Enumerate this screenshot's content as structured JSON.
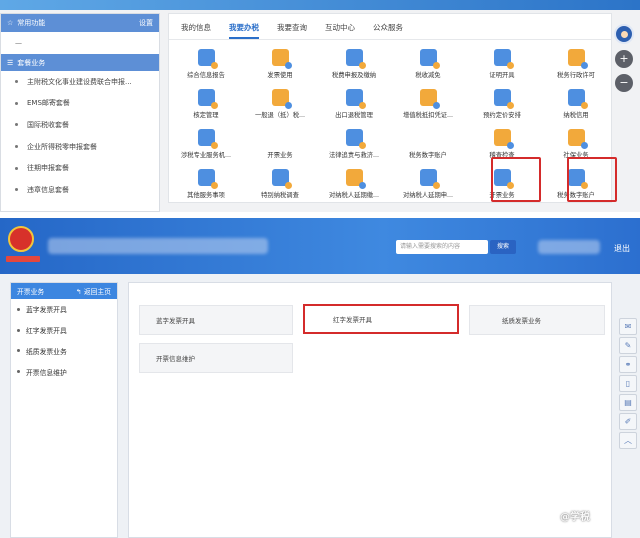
{
  "top": {
    "left_panel": {
      "header_label": "常用功能",
      "settings_label": "设置",
      "dash": "—",
      "section_label": "套餐业务",
      "items": [
        "主附税文化事业建设费联合申报...",
        "EMS邮寄套餐",
        "国际税收套餐",
        "企业所得税零申报套餐",
        "往期申报套餐",
        "违章信息套餐"
      ]
    },
    "tabs": [
      {
        "label": "我的信息",
        "active": false
      },
      {
        "label": "我要办税",
        "active": true
      },
      {
        "label": "我要查询",
        "active": false
      },
      {
        "label": "互动中心",
        "active": false
      },
      {
        "label": "公众服务",
        "active": false
      }
    ],
    "grid": [
      [
        {
          "label": "综合信息报告",
          "icon": "report-icon",
          "color": "blue",
          "name": "综合信息报告"
        },
        {
          "label": "发票使用",
          "icon": "invoice-icon",
          "color": "orange",
          "name": "发票使用"
        },
        {
          "label": "税费申报及缴纳",
          "icon": "tax-declare-icon",
          "color": "blue",
          "name": "税费申报及缴纳"
        },
        {
          "label": "税收减免",
          "icon": "tax-reduction-icon",
          "color": "blue",
          "name": "税收减免"
        },
        {
          "label": "证明开具",
          "icon": "certificate-icon",
          "color": "blue",
          "name": "证明开具"
        },
        {
          "label": "税务行政许可",
          "icon": "license-icon",
          "color": "orange",
          "name": "税务行政许可"
        }
      ],
      [
        {
          "label": "核定管理",
          "icon": "verify-icon",
          "color": "blue",
          "name": "核定管理"
        },
        {
          "label": "一般退（抵）税...",
          "icon": "refund-icon",
          "color": "orange",
          "name": "一般退抵税"
        },
        {
          "label": "出口退税管理",
          "icon": "export-refund-icon",
          "color": "blue",
          "name": "出口退税管理"
        },
        {
          "label": "增值税抵扣凭证...",
          "icon": "vat-voucher-icon",
          "color": "orange",
          "name": "增值税抵扣凭证"
        },
        {
          "label": "预约定价安排",
          "icon": "calendar-icon",
          "color": "blue",
          "name": "预约定价安排"
        },
        {
          "label": "纳税信用",
          "icon": "credit-icon",
          "color": "blue",
          "name": "纳税信用"
        }
      ],
      [
        {
          "label": "涉税专业服务机...",
          "icon": "building-icon",
          "color": "blue",
          "name": "涉税专业服务机构"
        },
        {
          "label": "开票业务",
          "icon": "blank-icon",
          "color": "none",
          "name": "开票业务-a"
        },
        {
          "label": "法律追责与救济...",
          "icon": "gavel-icon",
          "color": "blue",
          "name": "法律追责与救济"
        },
        {
          "label": "税务数字账户",
          "icon": "blank-icon",
          "color": "none",
          "name": "税务数字账户-a"
        },
        {
          "label": "稽查检查",
          "icon": "shield-icon",
          "color": "orange",
          "name": "稽查检查"
        },
        {
          "label": "社保业务",
          "icon": "social-security-icon",
          "color": "orange",
          "name": "社保业务"
        }
      ],
      [
        {
          "label": "其他服务事项",
          "icon": "heart-icon",
          "color": "blue",
          "name": "其他服务事项"
        },
        {
          "label": "特别纳税调查",
          "icon": "investigate-icon",
          "color": "blue",
          "name": "特别纳税调查"
        },
        {
          "label": "对纳税人延期缴...",
          "icon": "deferral-icon",
          "color": "orange",
          "name": "对纳税人延期缴"
        },
        {
          "label": "对纳税人延期申...",
          "icon": "deferral-declare-icon",
          "color": "blue",
          "name": "对纳税人延期申"
        },
        {
          "label": "开票业务",
          "icon": "invoicing-icon",
          "color": "blue",
          "name": "开票业务-b"
        },
        {
          "label": "税务数字账户",
          "icon": "digital-account-icon",
          "color": "blue",
          "name": "税务数字账户-b"
        }
      ]
    ],
    "tools": {
      "zoom_in": "+",
      "zoom_out": "−"
    }
  },
  "bottom": {
    "search_placeholder": "请输入需要搜索的内容",
    "search_button": "搜索",
    "logout": "退出",
    "side_title": "开票业务",
    "side_back": "返回主页",
    "side_items": [
      "蓝字发票开具",
      "红字发票开具",
      "纸质发票业务",
      "开票信息维护"
    ],
    "functions": [
      "蓝字发票开具",
      "红字发票开具",
      "纸质发票业务",
      "开票信息维护"
    ]
  },
  "watermark": "@学税"
}
